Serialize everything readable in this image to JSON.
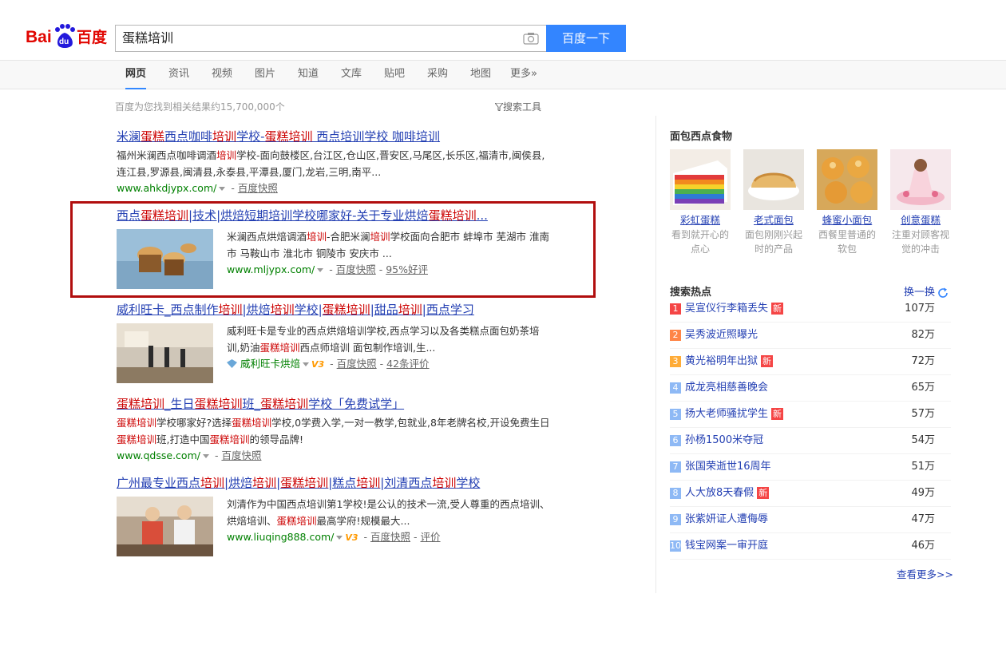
{
  "header": {
    "logo_text_bai": "Bai",
    "logo_text_du": "du",
    "logo_text_cn": "百度",
    "search_value": "蛋糕培训",
    "search_button": "百度一下"
  },
  "tabs": [
    "网页",
    "资讯",
    "视频",
    "图片",
    "知道",
    "文库",
    "贴吧",
    "采购",
    "地图",
    "更多»"
  ],
  "meta": {
    "result_count": "百度为您找到相关结果约15,700,000个",
    "search_tools": "搜索工具"
  },
  "results": [
    {
      "title_parts": [
        "米澜",
        "蛋糕",
        "西点咖啡",
        "培训",
        "学校-",
        "蛋糕培训",
        " 西点培训学校 咖啡培训"
      ],
      "abstract_parts": [
        "福州米澜西点咖啡调酒",
        "培训",
        "学校-面向鼓楼区,台江区,仓山区,晋安区,马尾区,长乐区,福清市,闽侯县,连江县,罗源县,闽清县,永泰县,平潭县,厦门,龙岩,三明,南平..."
      ],
      "url": "www.ahkdjypx.com/",
      "snapshot": "百度快照"
    },
    {
      "title_parts": [
        "西点",
        "蛋糕培训",
        "|技术|烘焙短期培训学校哪家好-关于专业烘焙",
        "蛋糕培训",
        "..."
      ],
      "abstract_parts": [
        "米澜西点烘焙调酒",
        "培训",
        "-合肥米澜",
        "培训",
        "学校面向合肥市 蚌埠市 芜湖市 淮南市 马鞍山市 淮北市 铜陵市 安庆市 ..."
      ],
      "url": "www.mljypx.com/",
      "snapshot": "百度快照",
      "rating": "95%好评"
    },
    {
      "title_parts": [
        "威利旺卡_西点制作",
        "培训",
        "|烘焙",
        "培训",
        "学校|",
        "蛋糕培训",
        "|甜品",
        "培训",
        "|西点学习"
      ],
      "abstract_parts": [
        "威利旺卡是专业的西点烘焙培训学校,西点学习以及各类糕点面包奶茶培训,奶油",
        "蛋糕培训",
        "西点师培训 面包制作培训,生..."
      ],
      "url": "威利旺卡烘焙",
      "v3": "V3",
      "snapshot": "百度快照",
      "rating": "42条评价"
    },
    {
      "title_parts": [
        "蛋糕培训",
        "_生日",
        "蛋糕培训",
        "班_",
        "蛋糕培训",
        "学校「免费试学」"
      ],
      "abstract_parts": [
        "蛋糕培训",
        "学校哪家好?选择",
        "蛋糕培训",
        "学校,0学费入学,一对一教学,包就业,8年老牌名校,开设免费生日",
        "蛋糕培训",
        "班,打造中国",
        "蛋糕培训",
        "的领导品牌!"
      ],
      "url": "www.qdsse.com/",
      "snapshot": "百度快照"
    },
    {
      "title_parts": [
        "广州最专业西点",
        "培训",
        "|烘焙",
        "培训",
        "|",
        "蛋糕培训",
        "|糕点",
        "培训",
        "|刘清西点",
        "培训",
        "学校"
      ],
      "abstract_parts": [
        "刘清作为中国西点培训第1学校!是公认的技术一流,受人尊重的西点培训、烘焙培训、",
        "蛋糕培训",
        "最高学府!规模最大..."
      ],
      "url": "www.liuqing888.com/",
      "v3": "V3",
      "snapshot": "百度快照",
      "rating": "评价"
    }
  ],
  "sidebar": {
    "food_title": "面包西点食物",
    "foods": [
      {
        "name": "彩虹蛋糕",
        "desc": "看到就开心的点心"
      },
      {
        "name": "老式面包",
        "desc": "面包刚刚兴起时的产品"
      },
      {
        "name": "蜂蜜小面包",
        "desc": "西餐里普通的软包"
      },
      {
        "name": "创意蛋糕",
        "desc": "注重对顾客视觉的冲击"
      }
    ],
    "hot_title": "搜索热点",
    "refresh": "换一换",
    "new_badge": "新",
    "hot": [
      {
        "rank": "1",
        "text": "吴宣仪行李箱丢失",
        "count": "107万",
        "new": true
      },
      {
        "rank": "2",
        "text": "吴秀波近照曝光",
        "count": "82万",
        "new": false
      },
      {
        "rank": "3",
        "text": "黄光裕明年出狱",
        "count": "72万",
        "new": true
      },
      {
        "rank": "4",
        "text": "成龙亮相慈善晚会",
        "count": "65万",
        "new": false
      },
      {
        "rank": "5",
        "text": "扬大老师骚扰学生",
        "count": "57万",
        "new": true
      },
      {
        "rank": "6",
        "text": "孙杨1500米夺冠",
        "count": "54万",
        "new": false
      },
      {
        "rank": "7",
        "text": "张国荣逝世16周年",
        "count": "51万",
        "new": false
      },
      {
        "rank": "8",
        "text": "人大放8天春假",
        "count": "49万",
        "new": true
      },
      {
        "rank": "9",
        "text": "张紫妍证人遭侮辱",
        "count": "47万",
        "new": false
      },
      {
        "rank": "10",
        "text": "钱宝网案一审开庭",
        "count": "46万",
        "new": false
      }
    ],
    "more": "查看更多>>"
  }
}
